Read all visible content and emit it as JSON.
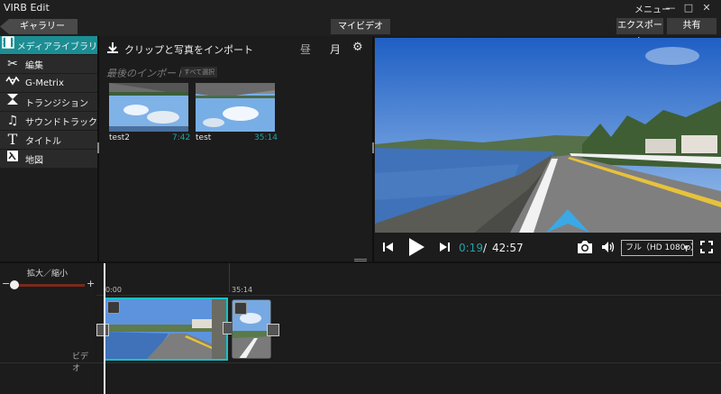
{
  "titlebar": {
    "app_title": "VIRB Edit",
    "menu_label": "メニュー"
  },
  "toolbar": {
    "gallery": "ギャラリー",
    "my_video": "マイビデオ",
    "export": "エクスポート",
    "share": "共有"
  },
  "sidebar": {
    "items": [
      {
        "label": "メディアライブラリ",
        "icon": "film-icon",
        "active": true
      },
      {
        "label": "編集",
        "icon": "scissors-icon"
      },
      {
        "label": "G-Metrix",
        "icon": "gmetrix-icon"
      },
      {
        "label": "トランジション",
        "icon": "transition-icon"
      },
      {
        "label": "サウンドトラック",
        "icon": "music-note-icon"
      },
      {
        "label": "タイトル",
        "icon": "title-t-icon"
      },
      {
        "label": "地図",
        "icon": "map-icon"
      }
    ]
  },
  "library": {
    "title": "クリップと写真をインポート",
    "day_label": "昼",
    "month_label": "月",
    "recent_title": "最後のインポート",
    "select_all": "すべて選択",
    "items": [
      {
        "name": "test2",
        "duration": "7:42"
      },
      {
        "name": "test",
        "duration": "35:14"
      }
    ]
  },
  "player": {
    "current_time": "0:19",
    "separator": "/",
    "total_time": "42:57",
    "quality": "フル（HD 1080p）"
  },
  "timeline": {
    "zoom_label": "拡大／縮小",
    "zoom_minus": "−",
    "zoom_plus": "+",
    "zoom_level": 0.0,
    "track_label": "ビデオ",
    "ticks": [
      "0:00",
      "35:14"
    ]
  },
  "colors": {
    "accent": "#1b8e93",
    "time_accent": "#1fa3a8",
    "selection": "#18c1c8"
  }
}
